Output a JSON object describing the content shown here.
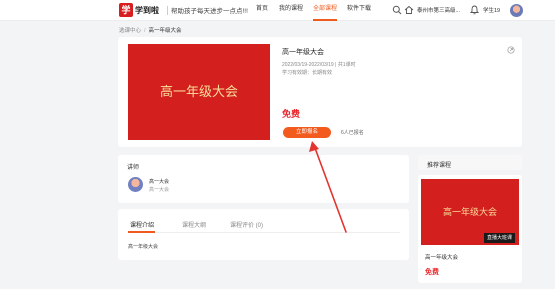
{
  "header": {
    "logo_mark": "学",
    "logo_text": "学到啦",
    "slogan": "帮助孩子每天进步一点点!!!",
    "nav": [
      {
        "label": "首页",
        "active": false
      },
      {
        "label": "我的课程",
        "active": false
      },
      {
        "label": "全部课程",
        "active": true
      },
      {
        "label": "软件下载",
        "active": false
      }
    ],
    "school": "泰州市第三高级...",
    "username": "学生19"
  },
  "breadcrumb": {
    "home": "选课中心",
    "separator": "/",
    "current": "高一年级大会"
  },
  "course": {
    "cover_text": "高一年级大会",
    "title": "高一年级大会",
    "dates": "2022/03/19-2022/03/19  |  共1课时",
    "validity": "学习有效期：长期有效",
    "price": "免费",
    "enroll_label": "立即报名",
    "enrolled_count": "6人已报名"
  },
  "lecturer": {
    "section_title": "讲师",
    "name": "高一大会",
    "desc": "高一大会"
  },
  "tabs": {
    "items": [
      {
        "label": "课程介绍",
        "active": true
      },
      {
        "label": "课程大纲",
        "active": false
      },
      {
        "label": "课程评价 (0)",
        "active": false
      }
    ],
    "intro_text": "高一年级大会"
  },
  "recommend": {
    "section_title": "推荐课程",
    "cover_text": "高一年级大会",
    "badge": "直播大班课",
    "name": "高一年级大会",
    "price": "免费"
  },
  "colors": {
    "accent": "#f05a1e",
    "price_red": "#e8262a",
    "cover_red": "#d41f1f",
    "cover_text": "#fadf9a"
  }
}
